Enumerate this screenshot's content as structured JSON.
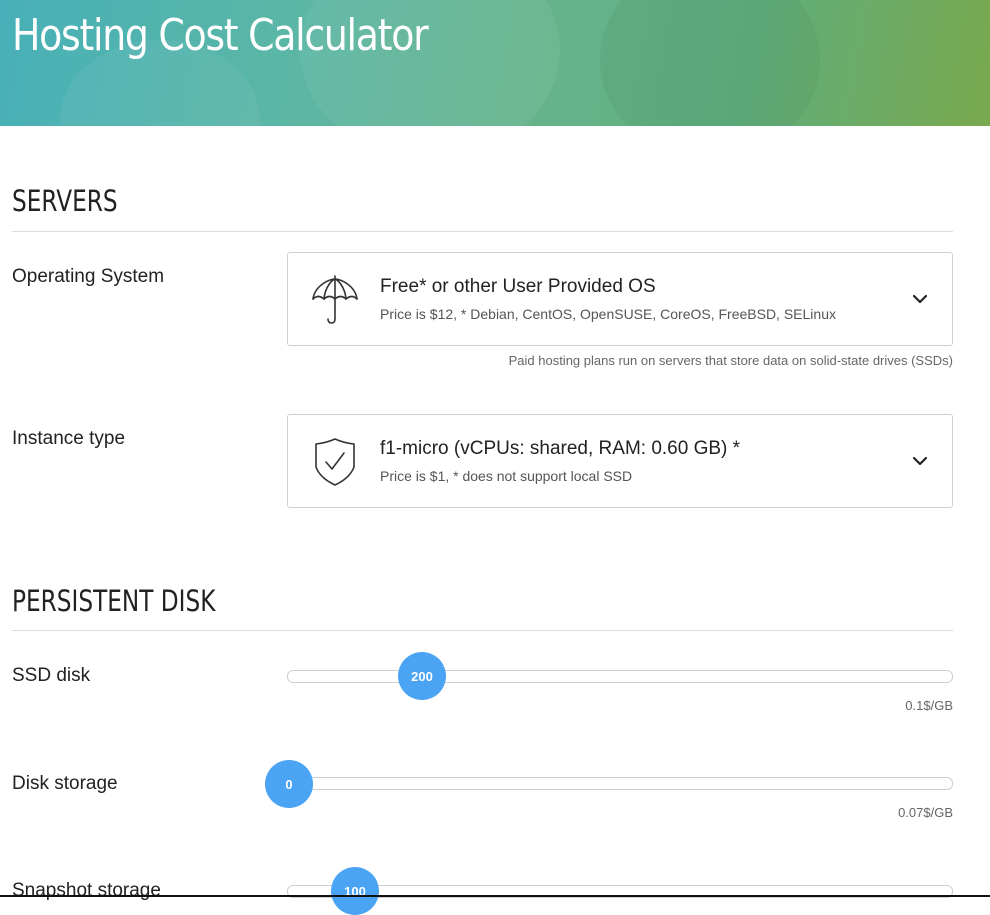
{
  "header": {
    "title": "Hosting Cost Calculator"
  },
  "servers": {
    "section_title": "SERVERS",
    "os": {
      "label": "Operating System",
      "selected_title": "Free* or other User Provided OS",
      "selected_sub": "Price is $12, * Debian, CentOS, OpenSUSE, CoreOS, FreeBSD, SELinux",
      "icon": "umbrella-icon",
      "hint": "Paid hosting plans run on servers that store data on solid-state drives (SSDs)"
    },
    "instance": {
      "label": "Instance type",
      "selected_title": "f1-micro (vCPUs: shared, RAM: 0.60 GB) *",
      "selected_sub": "Price is $1, * does not support local SSD",
      "icon": "shield-check-icon"
    }
  },
  "persistent_disk": {
    "section_title": "PERSISTENT DISK",
    "ssd": {
      "label": "SSD disk",
      "value": "200",
      "rate": "0.1$/GB"
    },
    "disk_storage": {
      "label": "Disk storage",
      "value": "0",
      "rate": "0.07$/GB"
    },
    "snapshot": {
      "label": "Snapshot storage",
      "value": "100"
    }
  },
  "colors": {
    "accent": "#4aa3f3",
    "header_start": "#48b0b8",
    "header_end": "#79a84e"
  }
}
